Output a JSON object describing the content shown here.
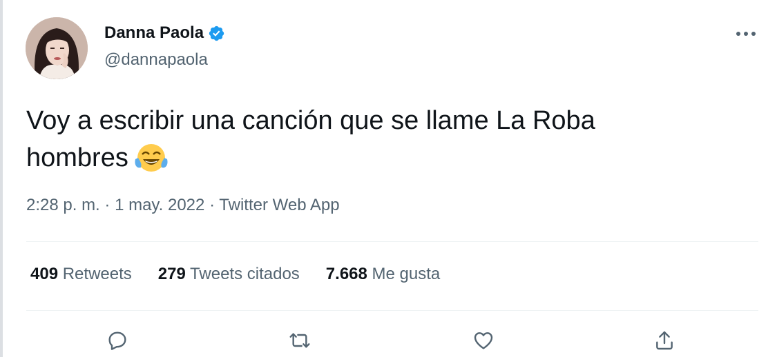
{
  "author": {
    "display_name": "Danna Paola",
    "handle": "@dannapaola",
    "verified_icon": "verified-badge-icon",
    "verified_color": "#1d9bf0"
  },
  "tweet": {
    "text_line1": "Voy a escribir una canción que se llame La Roba",
    "text_line2": "hombres",
    "emoji": "face-with-tears-of-joy",
    "time": "2:28 p. m.",
    "date": "1 may. 2022",
    "source": "Twitter Web App",
    "separator": "·"
  },
  "stats": {
    "retweets_count": "409",
    "retweets_label": "Retweets",
    "quotes_count": "279",
    "quotes_label": "Tweets citados",
    "likes_count": "7.668",
    "likes_label": "Me gusta"
  },
  "actions": [
    "reply-icon",
    "retweet-icon",
    "like-icon",
    "share-icon"
  ],
  "colors": {
    "text_primary": "#0f1419",
    "text_secondary": "#536471",
    "divider": "#eff3f4"
  }
}
